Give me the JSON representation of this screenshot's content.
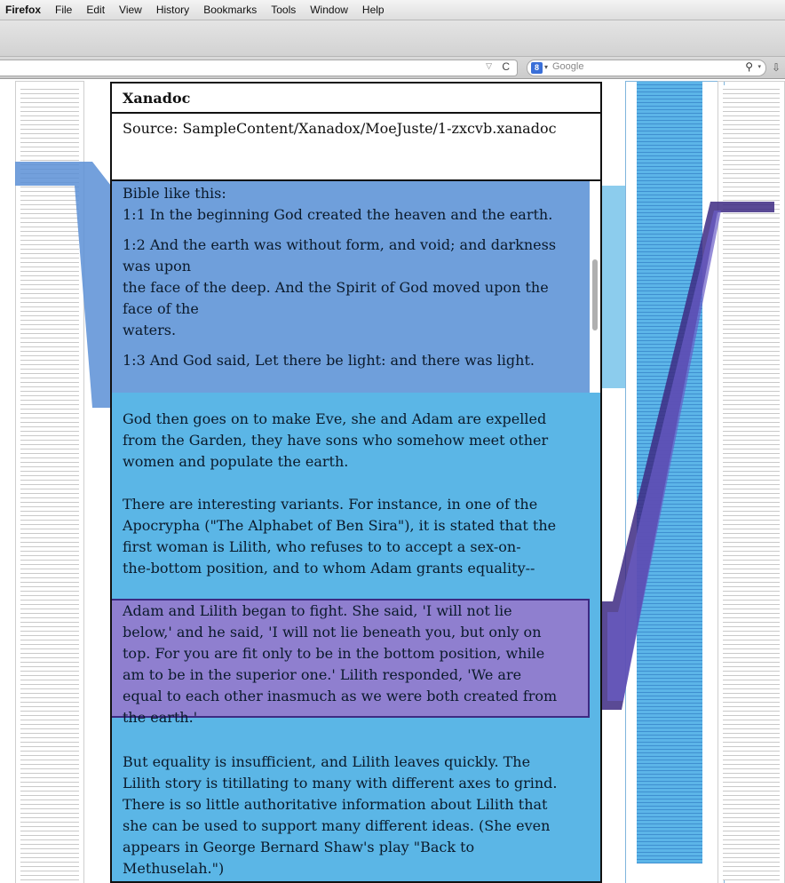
{
  "menubar": {
    "app": "Firefox",
    "items": [
      "File",
      "Edit",
      "View",
      "History",
      "Bookmarks",
      "Tools",
      "Window",
      "Help"
    ]
  },
  "search": {
    "placeholder": "Google"
  },
  "panel": {
    "title": "Xanadoc",
    "source": "Source: SampleContent/Xanadox/MoeJuste/1-zxcvb.xanadoc",
    "highlight_blue": [
      "Bible like this:",
      "1:1 In the beginning God created the heaven and the earth.",
      "1:2 And the earth was without form, and void; and darkness",
      "was upon",
      "the face of the deep. And the Spirit of God moved upon the",
      "face of the",
      "waters.",
      "1:3 And God said, Let there be light: and there was light."
    ],
    "para1": [
      "God then goes on to make Eve, she and Adam are expelled",
      "from the Garden, they have sons who somehow meet other",
      "women and populate the earth."
    ],
    "para2": [
      "There are interesting variants. For instance, in one of the",
      "Apocrypha (\"The Alphabet of Ben Sira\"), it is stated that the",
      "first woman is Lilith, who refuses to to accept a sex-on-",
      "the-bottom position, and to whom Adam grants equality--"
    ],
    "highlight_purple": [
      "Adam and Lilith began to fight. She said, 'I will not lie",
      "below,' and he said, 'I will not lie beneath you, but only on",
      "top. For you are fit only to be in the bottom position, while",
      "am to be in the superior one.' Lilith responded, 'We are",
      "equal to each other inasmuch as we were both created from",
      "the earth.'"
    ],
    "para3": [
      "But equality is insufficient, and Lilith leaves quickly. The",
      "Lilith story is titillating to many with different axes to grind.",
      "There is so little authoritative information about Lilith that",
      "she can be used to support many different ideas. (She even",
      "appears in George Bernard Shaw's play \"Back to",
      "Methuselah.\")"
    ]
  },
  "colors": {
    "blue_highlight": "#6f9fdb",
    "body_blue": "#5bb6e6",
    "purple_highlight": "#8f7fcf",
    "purple_border": "#3d2a82"
  }
}
